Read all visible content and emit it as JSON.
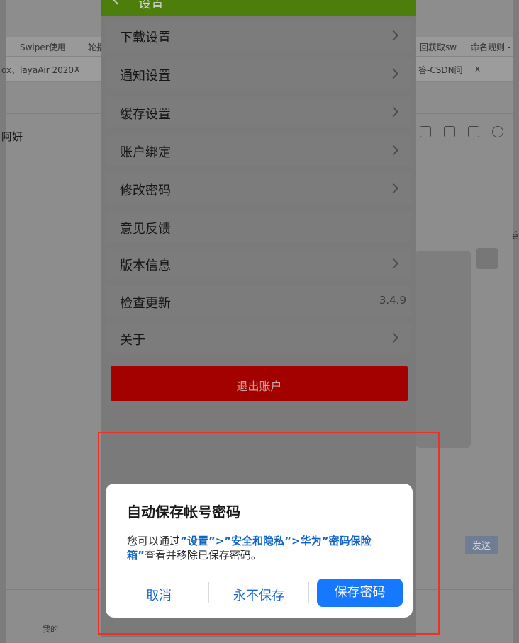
{
  "background": {
    "bookmarks": [
      "Swiper使用",
      "轮播",
      "回获取sw",
      "命名规则 -"
    ],
    "tabs": [
      "ox、layaAir 2020",
      "x",
      "答-CSDN问",
      "x"
    ],
    "side_text": [
      "阿妍",
      "我的",
      "发送"
    ],
    "right_char": "é"
  },
  "phone": {
    "header_title": "设置",
    "menu": [
      {
        "label": "下载设置",
        "chevron": true
      },
      {
        "label": "通知设置",
        "chevron": true
      },
      {
        "label": "缓存设置",
        "chevron": true
      },
      {
        "label": "账户绑定",
        "chevron": true
      },
      {
        "label": "修改密码",
        "chevron": true
      },
      {
        "label": "意见反馈",
        "chevron": false
      },
      {
        "label": "版本信息",
        "chevron": true
      },
      {
        "label": "检查更新",
        "version": "3.4.9"
      },
      {
        "label": "关于",
        "chevron": true
      }
    ],
    "logout_label": "退出账户"
  },
  "dialog": {
    "title": "自动保存帐号密码",
    "body_prefix": "您可以通过",
    "body_link": "”设置”>”安全和隐私”>华为”密码保险箱”",
    "body_suffix": "查看并移除已保存密码。",
    "cancel_label": "取消",
    "never_label": "永不保存",
    "save_label": "保存密码"
  },
  "colors": {
    "header_green": "#4d7d0a",
    "logout_red": "#a30000",
    "primary_blue": "#1677ff",
    "highlight_red": "#e8322a"
  }
}
